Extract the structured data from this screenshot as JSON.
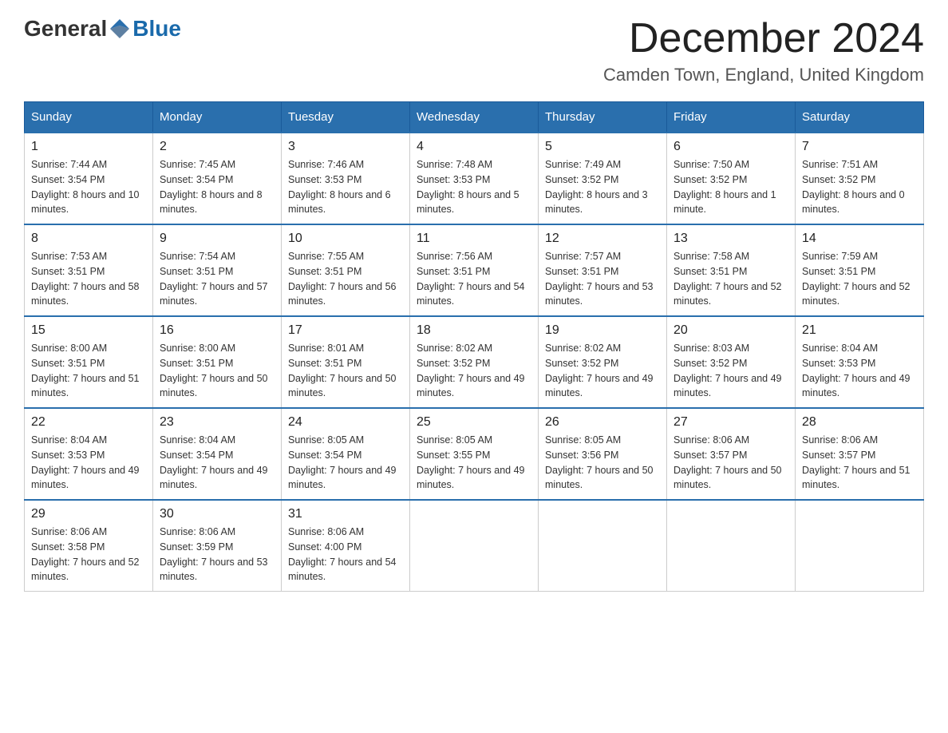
{
  "header": {
    "logo_general": "General",
    "logo_blue": "Blue",
    "month_title": "December 2024",
    "location": "Camden Town, England, United Kingdom"
  },
  "days_of_week": [
    "Sunday",
    "Monday",
    "Tuesday",
    "Wednesday",
    "Thursday",
    "Friday",
    "Saturday"
  ],
  "weeks": [
    [
      {
        "date": "1",
        "sunrise": "7:44 AM",
        "sunset": "3:54 PM",
        "daylight": "8 hours and 10 minutes."
      },
      {
        "date": "2",
        "sunrise": "7:45 AM",
        "sunset": "3:54 PM",
        "daylight": "8 hours and 8 minutes."
      },
      {
        "date": "3",
        "sunrise": "7:46 AM",
        "sunset": "3:53 PM",
        "daylight": "8 hours and 6 minutes."
      },
      {
        "date": "4",
        "sunrise": "7:48 AM",
        "sunset": "3:53 PM",
        "daylight": "8 hours and 5 minutes."
      },
      {
        "date": "5",
        "sunrise": "7:49 AM",
        "sunset": "3:52 PM",
        "daylight": "8 hours and 3 minutes."
      },
      {
        "date": "6",
        "sunrise": "7:50 AM",
        "sunset": "3:52 PM",
        "daylight": "8 hours and 1 minute."
      },
      {
        "date": "7",
        "sunrise": "7:51 AM",
        "sunset": "3:52 PM",
        "daylight": "8 hours and 0 minutes."
      }
    ],
    [
      {
        "date": "8",
        "sunrise": "7:53 AM",
        "sunset": "3:51 PM",
        "daylight": "7 hours and 58 minutes."
      },
      {
        "date": "9",
        "sunrise": "7:54 AM",
        "sunset": "3:51 PM",
        "daylight": "7 hours and 57 minutes."
      },
      {
        "date": "10",
        "sunrise": "7:55 AM",
        "sunset": "3:51 PM",
        "daylight": "7 hours and 56 minutes."
      },
      {
        "date": "11",
        "sunrise": "7:56 AM",
        "sunset": "3:51 PM",
        "daylight": "7 hours and 54 minutes."
      },
      {
        "date": "12",
        "sunrise": "7:57 AM",
        "sunset": "3:51 PM",
        "daylight": "7 hours and 53 minutes."
      },
      {
        "date": "13",
        "sunrise": "7:58 AM",
        "sunset": "3:51 PM",
        "daylight": "7 hours and 52 minutes."
      },
      {
        "date": "14",
        "sunrise": "7:59 AM",
        "sunset": "3:51 PM",
        "daylight": "7 hours and 52 minutes."
      }
    ],
    [
      {
        "date": "15",
        "sunrise": "8:00 AM",
        "sunset": "3:51 PM",
        "daylight": "7 hours and 51 minutes."
      },
      {
        "date": "16",
        "sunrise": "8:00 AM",
        "sunset": "3:51 PM",
        "daylight": "7 hours and 50 minutes."
      },
      {
        "date": "17",
        "sunrise": "8:01 AM",
        "sunset": "3:51 PM",
        "daylight": "7 hours and 50 minutes."
      },
      {
        "date": "18",
        "sunrise": "8:02 AM",
        "sunset": "3:52 PM",
        "daylight": "7 hours and 49 minutes."
      },
      {
        "date": "19",
        "sunrise": "8:02 AM",
        "sunset": "3:52 PM",
        "daylight": "7 hours and 49 minutes."
      },
      {
        "date": "20",
        "sunrise": "8:03 AM",
        "sunset": "3:52 PM",
        "daylight": "7 hours and 49 minutes."
      },
      {
        "date": "21",
        "sunrise": "8:04 AM",
        "sunset": "3:53 PM",
        "daylight": "7 hours and 49 minutes."
      }
    ],
    [
      {
        "date": "22",
        "sunrise": "8:04 AM",
        "sunset": "3:53 PM",
        "daylight": "7 hours and 49 minutes."
      },
      {
        "date": "23",
        "sunrise": "8:04 AM",
        "sunset": "3:54 PM",
        "daylight": "7 hours and 49 minutes."
      },
      {
        "date": "24",
        "sunrise": "8:05 AM",
        "sunset": "3:54 PM",
        "daylight": "7 hours and 49 minutes."
      },
      {
        "date": "25",
        "sunrise": "8:05 AM",
        "sunset": "3:55 PM",
        "daylight": "7 hours and 49 minutes."
      },
      {
        "date": "26",
        "sunrise": "8:05 AM",
        "sunset": "3:56 PM",
        "daylight": "7 hours and 50 minutes."
      },
      {
        "date": "27",
        "sunrise": "8:06 AM",
        "sunset": "3:57 PM",
        "daylight": "7 hours and 50 minutes."
      },
      {
        "date": "28",
        "sunrise": "8:06 AM",
        "sunset": "3:57 PM",
        "daylight": "7 hours and 51 minutes."
      }
    ],
    [
      {
        "date": "29",
        "sunrise": "8:06 AM",
        "sunset": "3:58 PM",
        "daylight": "7 hours and 52 minutes."
      },
      {
        "date": "30",
        "sunrise": "8:06 AM",
        "sunset": "3:59 PM",
        "daylight": "7 hours and 53 minutes."
      },
      {
        "date": "31",
        "sunrise": "8:06 AM",
        "sunset": "4:00 PM",
        "daylight": "7 hours and 54 minutes."
      },
      null,
      null,
      null,
      null
    ]
  ]
}
